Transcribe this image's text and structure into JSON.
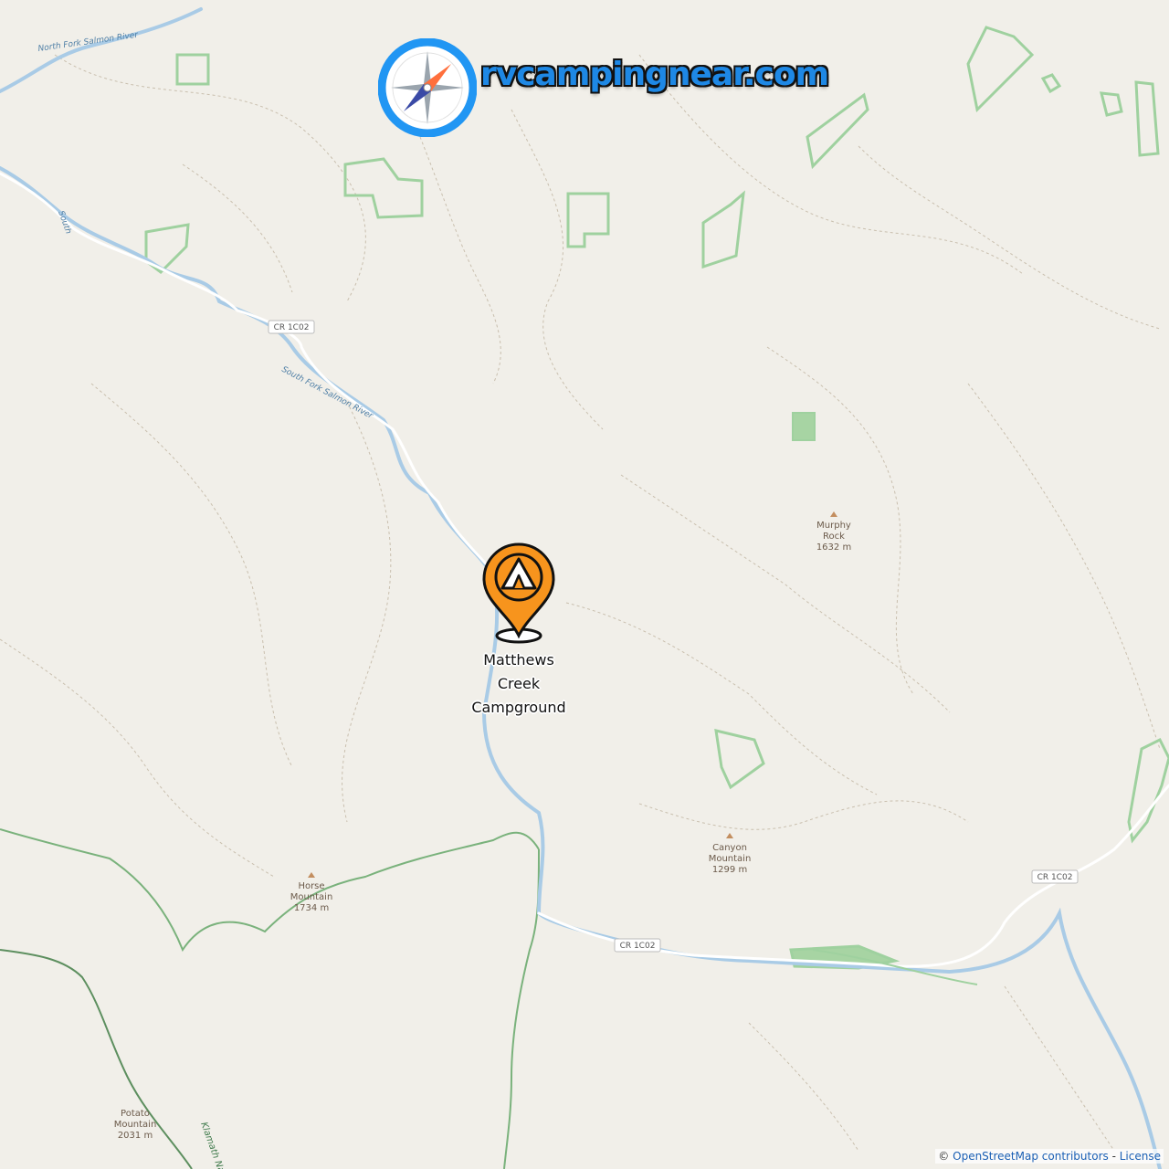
{
  "brand": {
    "site_name": "rvcampingnear.com",
    "compass_icon": "compass-icon"
  },
  "campground": {
    "name_line1": "Matthews",
    "name_line2": "Creek",
    "name_line3": "Campground",
    "icon": "tent-pin-icon",
    "color": "#f7941d"
  },
  "roads": {
    "shield_1": "CR 1C02",
    "shield_2": "CR 1C02",
    "shield_3": "CR 1C02"
  },
  "rivers": {
    "north_fork": "North Fork Salmon River",
    "south_fork": "South Fork Salmon River",
    "south_short": "South"
  },
  "peaks": [
    {
      "name_line1": "Murphy",
      "name_line2": "Rock",
      "elevation": "1632 m"
    },
    {
      "name_line1": "Canyon",
      "name_line2": "Mountain",
      "elevation": "1299 m"
    },
    {
      "name_line1": "Horse",
      "name_line2": "Mountain",
      "elevation": "1734 m"
    },
    {
      "name_line1": "Potato",
      "name_line2": "Mountain",
      "elevation": "2031 m"
    }
  ],
  "boundary": {
    "label": "Klamath Natio"
  },
  "attribution": {
    "prefix": "©",
    "osm": "OpenStreetMap contributors",
    "separator": "-",
    "license": "License"
  },
  "colors": {
    "land": "#f1efe9",
    "river": "#a9cbe6",
    "road": "#ffffff",
    "park": "#8cc68c",
    "trail": "#b9ae9b"
  }
}
